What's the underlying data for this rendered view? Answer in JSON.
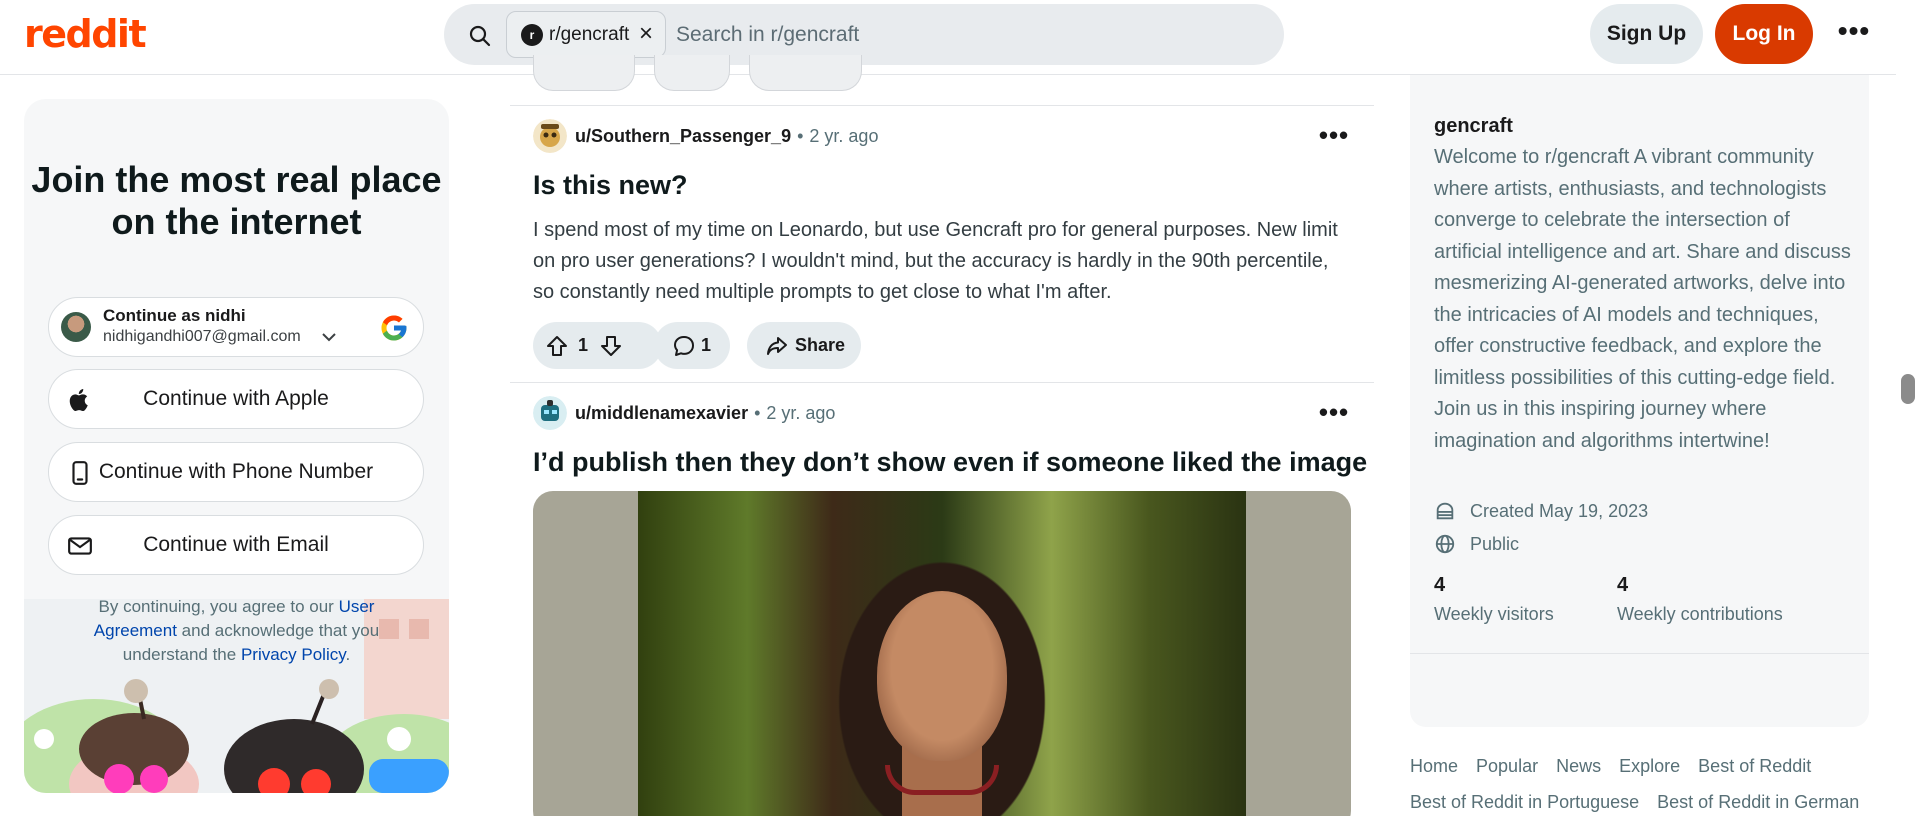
{
  "header": {
    "logo": "reddit",
    "search": {
      "community_chip": "r/gencraft",
      "placeholder": "Search in r/gencraft"
    },
    "sign_up": "Sign Up",
    "log_in": "Log In",
    "more": "•••"
  },
  "login_card": {
    "title": "Join the most real place on the internet",
    "google": {
      "name": "Continue as nidhi",
      "email": "nidhigandhi007@gmail.com"
    },
    "apple": "Continue with Apple",
    "phone": "Continue with Phone Number",
    "email": "Continue with Email",
    "legal": {
      "prefix": "By continuing, you agree to our ",
      "user_agreement": "User Agreement",
      "middle": " and acknowledge that you understand the ",
      "privacy_policy": "Privacy Policy",
      "suffix": "."
    }
  },
  "posts": [
    {
      "author": "u/Southern_Passenger_9",
      "time": "2 yr. ago",
      "title": "Is this new?",
      "body": "I spend most of my time on Leonardo, but use Gencraft pro for general purposes. New limit on pro user generations? I wouldn't mind, but the accuracy is hardly in the 90th percentile, so constantly need multiple prompts to get close to what I'm after.",
      "votes": "1",
      "comments": "1",
      "share": "Share"
    },
    {
      "author": "u/middlenamexavier",
      "time": "2 yr. ago",
      "title": "I’d publish then they don’t show even if someone liked the image"
    }
  ],
  "sidebar": {
    "name": "gencraft",
    "description": "Welcome to r/gencraft A vibrant community where artists, enthusiasts, and technologists converge to celebrate the intersection of artificial intelligence and art. Share and discuss mesmerizing AI-generated artworks, delve into the intricacies of AI models and techniques, offer constructive feedback, and explore the limitless possibilities of this cutting-edge field. Join us in this inspiring journey where imagination and algorithms intertwine!",
    "created": "Created May 19, 2023",
    "visibility": "Public",
    "weekly_visitors": "4",
    "weekly_visitors_label": "Weekly visitors",
    "weekly_contributions": "4",
    "weekly_contributions_label": "Weekly contributions"
  },
  "footer_links": [
    "Home",
    "Popular",
    "News",
    "Explore",
    "Best of Reddit",
    "Best of Reddit in Portuguese",
    "Best of Reddit in German"
  ],
  "colors": {
    "brand": "#ff4500",
    "login_button": "#d93a00",
    "link": "#0045ac"
  }
}
